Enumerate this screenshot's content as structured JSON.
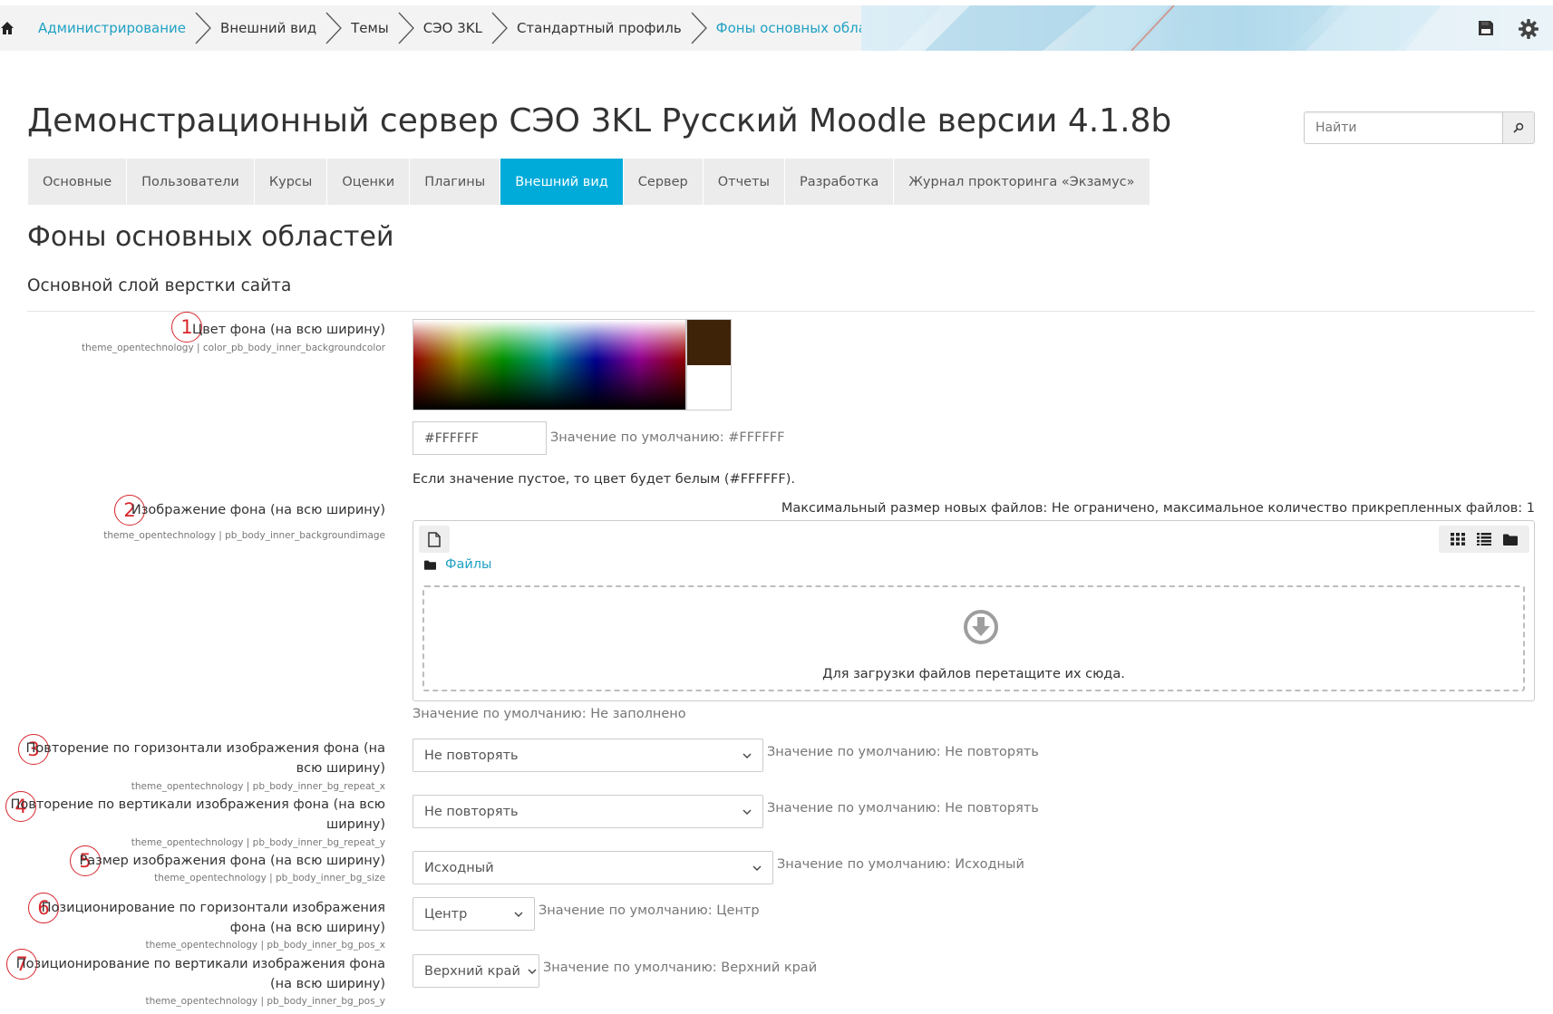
{
  "breadcrumb": {
    "items": [
      {
        "label": "Администрирование",
        "link": true
      },
      {
        "label": "Внешний вид",
        "link": false
      },
      {
        "label": "Темы",
        "link": false
      },
      {
        "label": "СЭО 3KL",
        "link": false
      },
      {
        "label": "Стандартный профиль",
        "link": false
      },
      {
        "label": "Фоны основных областей",
        "link": true
      }
    ]
  },
  "header": {
    "site_title": "Демонстрационный сервер СЭО 3KL Русский Moodle версии 4.1.8b",
    "search_placeholder": "Найти"
  },
  "nav": {
    "tabs": [
      "Основные",
      "Пользователи",
      "Курсы",
      "Оценки",
      "Плагины",
      "Внешний вид",
      "Сервер",
      "Отчеты",
      "Разработка",
      "Журнал прокторинга «Экзамус»"
    ],
    "active_index": 5
  },
  "page": {
    "title": "Фоны основных областей",
    "section": "Основной слой верстки сайта"
  },
  "settings": {
    "bg_color": {
      "number": "1",
      "label": "Цвет фона (на всю ширину)",
      "key": "theme_opentechnology | color_pb_body_inner_backgroundcolor",
      "value": "#FFFFFF",
      "default": "Значение по умолчанию: #FFFFFF",
      "note": "Если значение пустое, то цвет будет белым (#FFFFFF).",
      "preview_color": "#3f2308"
    },
    "bg_image": {
      "number": "2",
      "label": "Изображение фона (на всю ширину)",
      "key": "theme_opentechnology | pb_body_inner_backgroundimage",
      "limit": "Максимальный размер новых файлов: Не ограничено, максимальное количество прикрепленных файлов: 1",
      "files_link": "Файлы",
      "drop_text": "Для загрузки файлов перетащите их сюда.",
      "default": "Значение по умолчанию: Не заполнено"
    },
    "repeat_x": {
      "number": "3",
      "label_line1": "Повторение по горизонтали изображения фона (на",
      "label_line2": "всю ширину)",
      "key": "theme_opentechnology | pb_body_inner_bg_repeat_x",
      "value": "Не повторять",
      "default": "Значение по умолчанию: Не повторять"
    },
    "repeat_y": {
      "number": "4",
      "label_line1": "Повторение по вертикали изображения фона (на всю",
      "label_line2": "ширину)",
      "key": "theme_opentechnology | pb_body_inner_bg_repeat_y",
      "value": "Не повторять",
      "default": "Значение по умолчанию: Не повторять"
    },
    "size": {
      "number": "5",
      "label": "Размер изображения фона (на всю ширину)",
      "key": "theme_opentechnology | pb_body_inner_bg_size",
      "value": "Исходный",
      "default": "Значение по умолчанию: Исходный"
    },
    "pos_x": {
      "number": "6",
      "label_line1": "Позиционирование по горизонтали изображения",
      "label_line2": "фона (на всю ширину)",
      "key": "theme_opentechnology | pb_body_inner_bg_pos_x",
      "value": "Центр",
      "default": "Значение по умолчанию: Центр"
    },
    "pos_y": {
      "number": "7",
      "label_line1": "Позиционирование по вертикали изображения фона",
      "label_line2": "(на всю ширину)",
      "key": "theme_opentechnology | pb_body_inner_bg_pos_y",
      "value": "Верхний край",
      "default": "Значение по умолчанию: Верхний край"
    }
  },
  "icons": {
    "home": "home-icon",
    "save": "save-icon",
    "settings": "gear-icon",
    "search": "search-icon",
    "add_file": "file-icon",
    "folder": "folder-icon",
    "drop": "download-arrow-icon",
    "views": [
      "grid-view-icon",
      "list-view-icon",
      "tree-view-icon"
    ]
  },
  "colors": {
    "accent": "#00abd9",
    "link": "#1fa1c4",
    "annotation": "#d7262c"
  }
}
